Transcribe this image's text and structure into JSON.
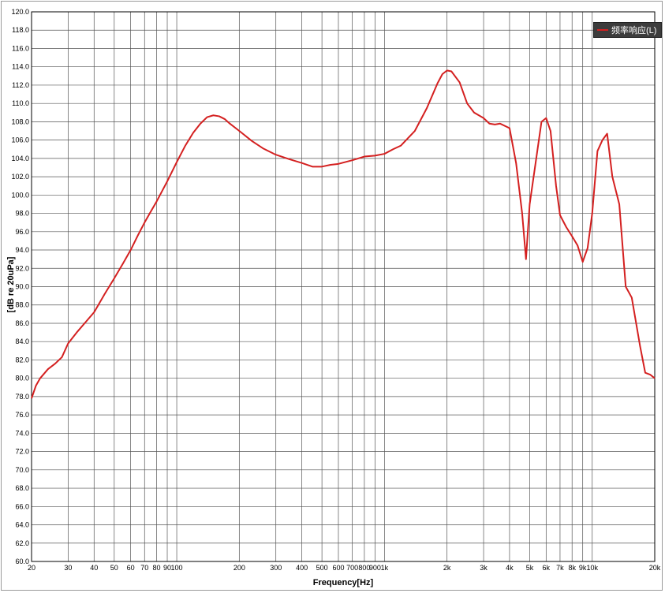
{
  "chart_data": {
    "type": "line",
    "title": "",
    "xlabel": "Frequency[Hz]",
    "ylabel": "[dB re 20uPa]",
    "x_scale": "log",
    "xlim": [
      20,
      20000
    ],
    "ylim": [
      60,
      120
    ],
    "grid": true,
    "legend_position": "top-right",
    "colors": {
      "series": "#d42020",
      "grid": "#555555",
      "legend_bg": "#3c3c3c"
    },
    "x_ticks": [
      {
        "value": 20,
        "label": "20"
      },
      {
        "value": 30,
        "label": "30"
      },
      {
        "value": 40,
        "label": "40"
      },
      {
        "value": 50,
        "label": "50"
      },
      {
        "value": 60,
        "label": "60"
      },
      {
        "value": 70,
        "label": "70"
      },
      {
        "value": 80,
        "label": "80"
      },
      {
        "value": 90,
        "label": "90"
      },
      {
        "value": 100,
        "label": "100"
      },
      {
        "value": 200,
        "label": "200"
      },
      {
        "value": 300,
        "label": "300"
      },
      {
        "value": 400,
        "label": "400"
      },
      {
        "value": 500,
        "label": "500"
      },
      {
        "value": 600,
        "label": "600"
      },
      {
        "value": 700,
        "label": "700"
      },
      {
        "value": 800,
        "label": "800"
      },
      {
        "value": 900,
        "label": "900"
      },
      {
        "value": 1000,
        "label": "1k"
      },
      {
        "value": 2000,
        "label": "2k"
      },
      {
        "value": 3000,
        "label": "3k"
      },
      {
        "value": 4000,
        "label": "4k"
      },
      {
        "value": 5000,
        "label": "5k"
      },
      {
        "value": 6000,
        "label": "6k"
      },
      {
        "value": 7000,
        "label": "7k"
      },
      {
        "value": 8000,
        "label": "8k"
      },
      {
        "value": 9000,
        "label": "9k"
      },
      {
        "value": 10000,
        "label": "10k"
      },
      {
        "value": 20000,
        "label": "20k"
      }
    ],
    "y_ticks": [
      "60.0",
      "62.0",
      "64.0",
      "66.0",
      "68.0",
      "70.0",
      "72.0",
      "74.0",
      "76.0",
      "78.0",
      "80.0",
      "82.0",
      "84.0",
      "86.0",
      "88.0",
      "90.0",
      "92.0",
      "94.0",
      "96.0",
      "98.0",
      "100.0",
      "102.0",
      "104.0",
      "106.0",
      "108.0",
      "110.0",
      "112.0",
      "114.0",
      "116.0",
      "118.0",
      "120.0"
    ],
    "series": [
      {
        "name": "频率响应(L)",
        "points": [
          [
            20,
            77.8
          ],
          [
            21,
            79.2
          ],
          [
            22,
            80.0
          ],
          [
            24,
            81.0
          ],
          [
            26,
            81.6
          ],
          [
            28,
            82.3
          ],
          [
            30,
            83.8
          ],
          [
            33,
            85.0
          ],
          [
            36,
            86.0
          ],
          [
            40,
            87.2
          ],
          [
            45,
            89.2
          ],
          [
            50,
            90.9
          ],
          [
            55,
            92.5
          ],
          [
            60,
            94.0
          ],
          [
            65,
            95.6
          ],
          [
            70,
            97.0
          ],
          [
            75,
            98.2
          ],
          [
            80,
            99.3
          ],
          [
            90,
            101.5
          ],
          [
            100,
            103.6
          ],
          [
            110,
            105.4
          ],
          [
            120,
            106.8
          ],
          [
            130,
            107.8
          ],
          [
            140,
            108.5
          ],
          [
            150,
            108.7
          ],
          [
            160,
            108.6
          ],
          [
            170,
            108.3
          ],
          [
            180,
            107.8
          ],
          [
            200,
            107.0
          ],
          [
            230,
            105.9
          ],
          [
            260,
            105.1
          ],
          [
            300,
            104.4
          ],
          [
            350,
            103.9
          ],
          [
            400,
            103.5
          ],
          [
            450,
            103.1
          ],
          [
            500,
            103.1
          ],
          [
            550,
            103.3
          ],
          [
            600,
            103.4
          ],
          [
            700,
            103.8
          ],
          [
            800,
            104.2
          ],
          [
            900,
            104.3
          ],
          [
            1000,
            104.5
          ],
          [
            1100,
            105.0
          ],
          [
            1200,
            105.4
          ],
          [
            1400,
            107.0
          ],
          [
            1600,
            109.5
          ],
          [
            1800,
            112.2
          ],
          [
            1900,
            113.2
          ],
          [
            2000,
            113.6
          ],
          [
            2100,
            113.5
          ],
          [
            2300,
            112.3
          ],
          [
            2500,
            110.0
          ],
          [
            2700,
            109.0
          ],
          [
            3000,
            108.4
          ],
          [
            3200,
            107.8
          ],
          [
            3400,
            107.7
          ],
          [
            3600,
            107.8
          ],
          [
            4000,
            107.3
          ],
          [
            4300,
            103.5
          ],
          [
            4600,
            98.0
          ],
          [
            4800,
            93.0
          ],
          [
            5000,
            99.0
          ],
          [
            5300,
            103.0
          ],
          [
            5700,
            108.0
          ],
          [
            6000,
            108.4
          ],
          [
            6300,
            107.0
          ],
          [
            6700,
            101.0
          ],
          [
            7000,
            97.8
          ],
          [
            7500,
            96.5
          ],
          [
            8000,
            95.5
          ],
          [
            8500,
            94.5
          ],
          [
            9000,
            92.7
          ],
          [
            9500,
            94.2
          ],
          [
            10000,
            98.0
          ],
          [
            10600,
            104.8
          ],
          [
            11200,
            106.0
          ],
          [
            11800,
            106.7
          ],
          [
            12500,
            102.0
          ],
          [
            13500,
            99.0
          ],
          [
            14500,
            90.0
          ],
          [
            15500,
            88.8
          ],
          [
            17000,
            83.5
          ],
          [
            18000,
            80.6
          ],
          [
            19000,
            80.4
          ],
          [
            20000,
            80.0
          ]
        ]
      }
    ]
  }
}
